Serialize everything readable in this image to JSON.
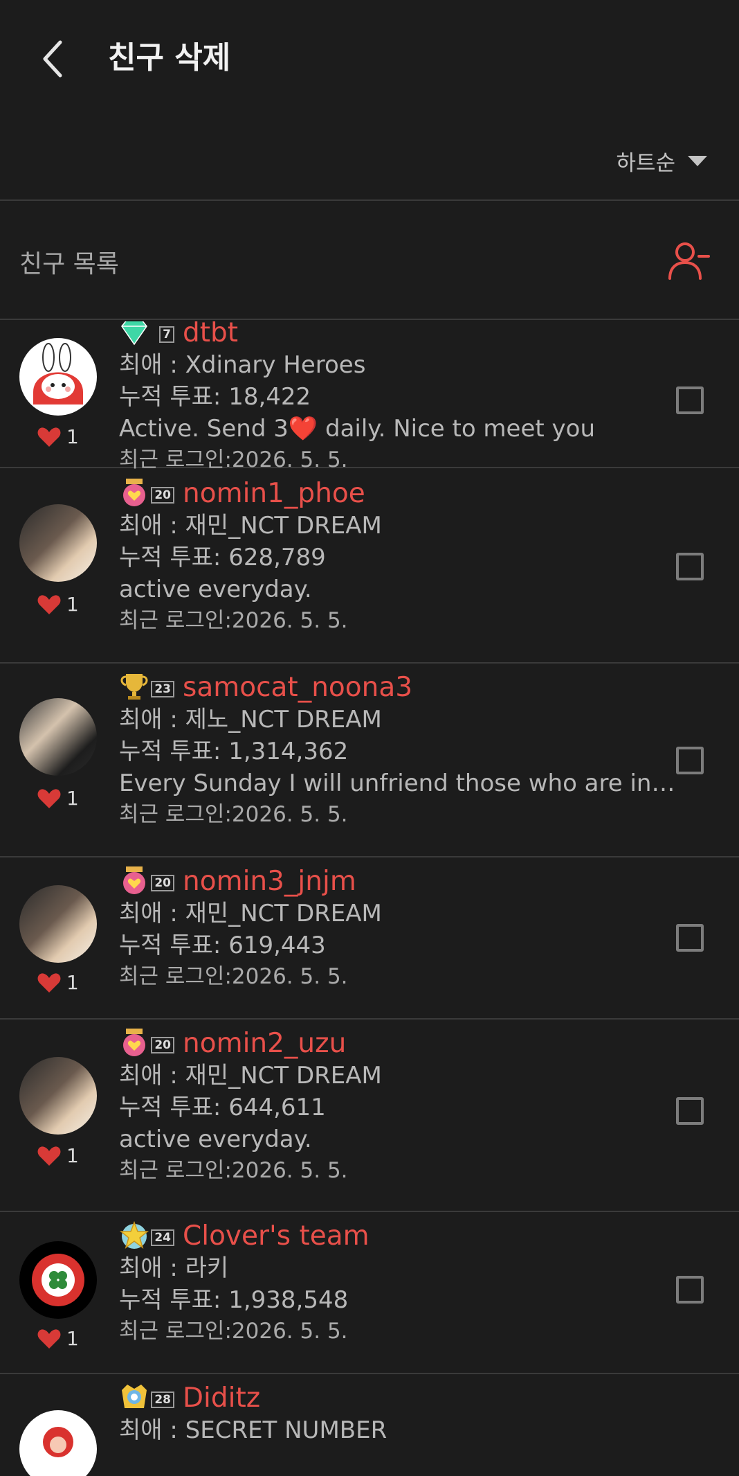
{
  "header": {
    "title": "친구 삭제",
    "back_icon": "chevron-left-icon"
  },
  "sort": {
    "label": "하트순",
    "icon": "caret-down-icon"
  },
  "list_header": {
    "title": "친구 목록",
    "remove_icon": "user-minus-icon"
  },
  "colors": {
    "accent": "#e8504a",
    "background": "#1c1c1c",
    "divider": "#3a3a3a"
  },
  "labels": {
    "fav_prefix": "최애 : ",
    "votes_prefix": "누적 투표: ",
    "login_prefix": "최근 로그인:"
  },
  "friends": [
    {
      "level": "7",
      "badge": "diamond-badge",
      "name": "dtbt",
      "fav": "Xdinary Heroes",
      "votes": "18,422",
      "status": "Active. Send 3❤️ daily. Nice to meet you",
      "login": "2026. 5. 5.",
      "hearts": "1",
      "avatar": "bunny-character-avatar"
    },
    {
      "level": "20",
      "badge": "heart-crown-badge",
      "name": "nomin1_phoe",
      "fav": "재민_NCT DREAM",
      "votes": "628,789",
      "status": "active everyday.",
      "login": "2026. 5. 5.",
      "hearts": "1",
      "avatar": "photo-avatar"
    },
    {
      "level": "23",
      "badge": "trophy-badge",
      "name": "samocat_noona3",
      "fav": "제노_NCT DREAM",
      "votes": "1,314,362",
      "status": "Every Sunday I will unfriend those who are inactive",
      "login": "2026. 5. 5.",
      "hearts": "1",
      "avatar": "photo-avatar"
    },
    {
      "level": "20",
      "badge": "heart-crown-badge",
      "name": "nomin3_jnjm",
      "fav": "재민_NCT DREAM",
      "votes": "619,443",
      "status": "",
      "login": "2026. 5. 5.",
      "hearts": "1",
      "avatar": "photo-avatar"
    },
    {
      "level": "20",
      "badge": "heart-crown-badge",
      "name": "nomin2_uzu",
      "fav": "재민_NCT DREAM",
      "votes": "644,611",
      "status": "active everyday.",
      "login": "2026. 5. 5.",
      "hearts": "1",
      "avatar": "photo-avatar"
    },
    {
      "level": "24",
      "badge": "star-badge",
      "name": "Clover's team",
      "fav": "라키",
      "votes": "1,938,548",
      "status": "",
      "login": "2026. 5. 5.",
      "hearts": "1",
      "avatar": "clover-logo-avatar"
    },
    {
      "level": "28",
      "badge": "sun-crown-badge",
      "name": "Diditz",
      "fav": "SECRET NUMBER",
      "votes": "",
      "status": "",
      "login": "",
      "hearts": "",
      "avatar": "character-avatar"
    }
  ]
}
